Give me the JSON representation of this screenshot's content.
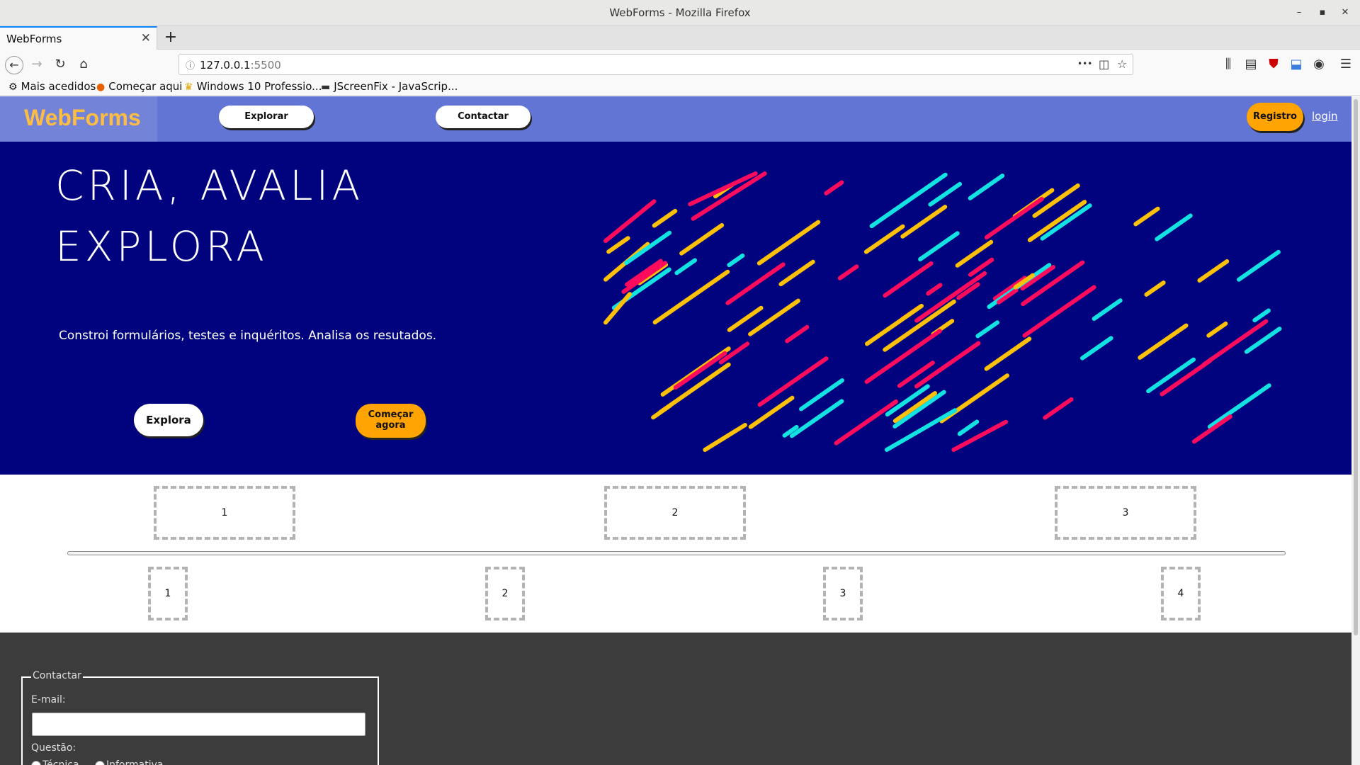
{
  "window": {
    "title": "WebForms - Mozilla Firefox",
    "minimize_glyph": "–",
    "maximize_glyph": "▪",
    "close_glyph": "✕"
  },
  "tabs": [
    {
      "label": "WebForms",
      "close_glyph": "✕"
    }
  ],
  "new_tab_glyph": "+",
  "navbar": {
    "back_icon": "arrow-left-icon",
    "forward_icon": "arrow-right-icon",
    "reload_icon": "reload-icon",
    "home_icon": "home-icon",
    "url_host": "127.0.0.1",
    "url_port": ":5500",
    "more_glyph": "•••"
  },
  "bookmarks": [
    {
      "label": "Mais acedidos",
      "icon": "gear-icon",
      "glyph": "⚙"
    },
    {
      "label": "Começar aqui",
      "icon": "firefox-icon",
      "glyph": "●"
    },
    {
      "label": "Windows 10 Professio...",
      "icon": "crown-icon",
      "glyph": "♛"
    },
    {
      "label": "JScreenFix - JavaScrip...",
      "icon": "monitor-icon",
      "glyph": "▬"
    }
  ],
  "site": {
    "logo": "WebForms",
    "nav": {
      "explorar": "Explorar",
      "contactar": "Contactar",
      "registro": "Registro",
      "login": "login"
    },
    "hero": {
      "title_line1": "CRIA, AVALIA",
      "title_line2": "EXPLORA",
      "subtitle": "Constroi formulários, testes e inquéritos. Analisa os resutados.",
      "btn_explora": "Explora",
      "btn_comecar_line1": "Começar",
      "btn_comecar_line2": "agora"
    },
    "boxes_row1": [
      "1",
      "2",
      "3"
    ],
    "boxes_row2": [
      "1",
      "2",
      "3",
      "4"
    ],
    "contact_form": {
      "legend": "Contactar",
      "email_label": "E-mail:",
      "question_label": "Questão:",
      "options": [
        "Técnica",
        "Informativa"
      ]
    }
  },
  "colors": {
    "header_bg": "#6375d4",
    "hero_bg": "#00037d",
    "accent_orange": "#ffa402",
    "logo_color": "#fcbd42",
    "stripe_yellow": "#ffc107",
    "stripe_cyan": "#13e2e2",
    "stripe_pink": "#ff0b5e",
    "footer_bg": "#3c3c3c"
  }
}
